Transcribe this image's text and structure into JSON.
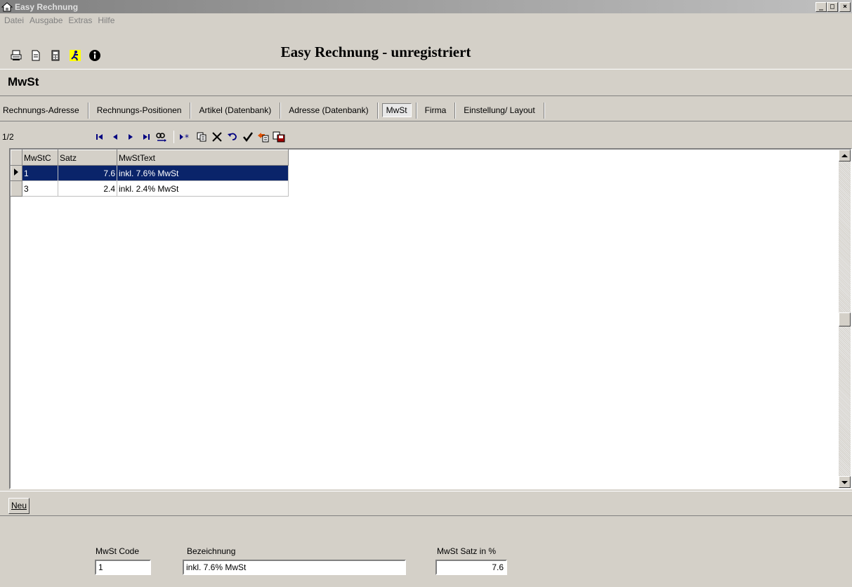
{
  "window": {
    "title": "Easy Rechnung",
    "controls": [
      "_",
      "□",
      "×"
    ]
  },
  "menu": [
    "Datei",
    "Ausgabe",
    "Extras",
    "Hilfe"
  ],
  "app_heading": "Easy Rechnung - unregistriert",
  "section_title": "MwSt",
  "tabs": [
    {
      "label": "Rechnungs-Adresse",
      "active": false
    },
    {
      "label": "Rechnungs-Positionen",
      "active": false
    },
    {
      "label": "Artikel (Datenbank)",
      "active": false
    },
    {
      "label": "Adresse (Datenbank)",
      "active": false
    },
    {
      "label": "MwSt",
      "active": true
    },
    {
      "label": "Firma",
      "active": false
    },
    {
      "label": "Einstellung/ Layout",
      "active": false
    }
  ],
  "navigator": {
    "record_counter": "1/2"
  },
  "grid": {
    "columns": [
      "MwStC",
      "Satz",
      "MwStText"
    ],
    "rows": [
      {
        "code": "1",
        "satz": "7.6",
        "text": "inkl. 7.6% MwSt",
        "selected": true
      },
      {
        "code": "3",
        "satz": "2.4",
        "text": "inkl. 2.4% MwSt",
        "selected": false
      }
    ]
  },
  "buttons": {
    "new_label": "Neu"
  },
  "form": {
    "code_label": "MwSt Code",
    "code_value": "1",
    "bezeichnung_label": "Bezeichnung",
    "bezeichnung_value": "inkl. 7.6% MwSt",
    "satz_label": "MwSt Satz in %",
    "satz_value": "7.6"
  },
  "colors": {
    "selection": "#0a246a",
    "face": "#d4d0c8",
    "title_gradient_start": "#808080"
  }
}
